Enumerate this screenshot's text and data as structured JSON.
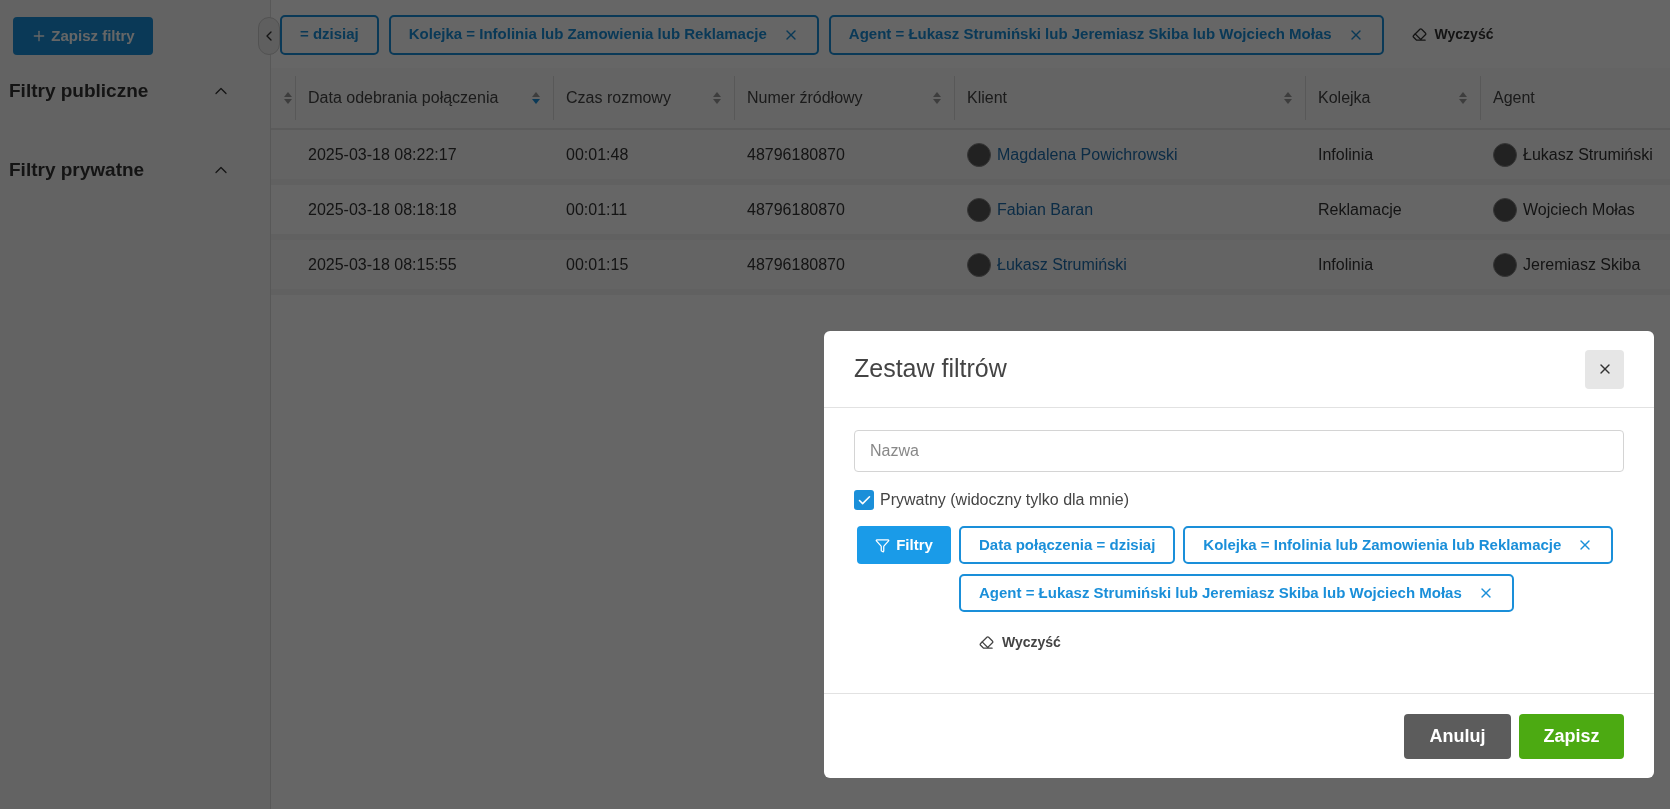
{
  "sidebar": {
    "save_button": "Zapisz filtry",
    "sections": [
      {
        "title": "Filtry publiczne",
        "expanded": true
      },
      {
        "title": "Filtry prywatne",
        "expanded": true
      }
    ]
  },
  "filter_bar": {
    "chips": [
      {
        "label": "= dzisiaj",
        "removable": false
      },
      {
        "label": "Kolejka = Infolinia lub Zamowienia lub Reklamacje",
        "removable": true
      },
      {
        "label": "Agent = Łukasz Strumiński lub Jeremiasz Skiba lub Wojciech Mołas",
        "removable": true
      }
    ],
    "clear": "Wyczyść"
  },
  "table": {
    "columns": [
      {
        "sorted": false
      },
      {
        "label": "Data odebrania połączenia",
        "sorted": true
      },
      {
        "label": "Czas rozmowy",
        "sorted": false
      },
      {
        "label": "Numer źródłowy",
        "sorted": false
      },
      {
        "label": "Klient",
        "sorted": false
      },
      {
        "label": "Kolejka",
        "sorted": false
      },
      {
        "label": "Agent"
      }
    ],
    "rows": [
      {
        "date": "2025-03-18 08:22:17",
        "duration": "00:01:48",
        "number": "48796180870",
        "client": "Magdalena Powichrowski",
        "queue": "Infolinia",
        "agent": "Łukasz Strumiński"
      },
      {
        "date": "2025-03-18 08:18:18",
        "duration": "00:01:11",
        "number": "48796180870",
        "client": "Fabian Baran",
        "queue": "Reklamacje",
        "agent": "Wojciech Mołas"
      },
      {
        "date": "2025-03-18 08:15:55",
        "duration": "00:01:15",
        "number": "48796180870",
        "client": "Łukasz Strumiński",
        "queue": "Infolinia",
        "agent": "Jeremiasz Skiba"
      }
    ]
  },
  "modal": {
    "title": "Zestaw filtrów",
    "name_field": {
      "placeholder": "Nazwa"
    },
    "private_checkbox": {
      "label": "Prywatny (widoczny tylko dla mnie)",
      "checked": true
    },
    "filters_button": "Filtry",
    "chips": [
      {
        "label": "Data połączenia = dzisiaj",
        "removable": false
      },
      {
        "label": "Kolejka = Infolinia lub Zamowienia lub Reklamacje",
        "removable": true
      },
      {
        "label": "Agent = Łukasz Strumiński lub Jeremiasz Skiba lub Wojciech Mołas",
        "removable": true
      }
    ],
    "clear": "Wyczyść",
    "buttons": {
      "cancel": "Anuluj",
      "save": "Zapisz"
    }
  }
}
